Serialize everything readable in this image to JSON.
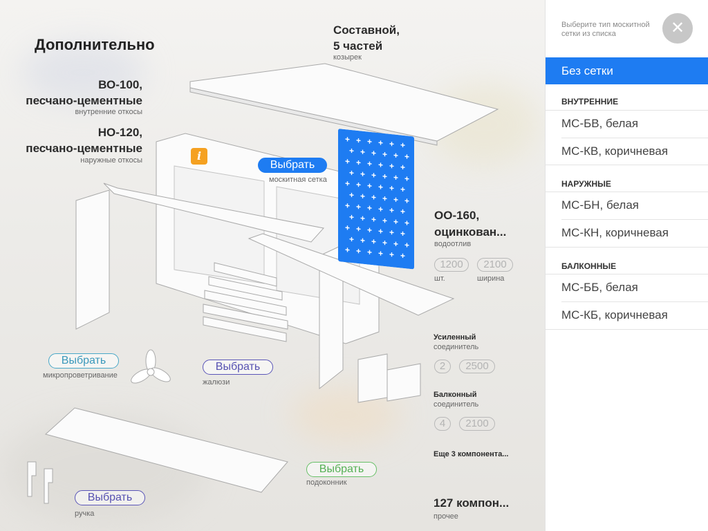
{
  "main": {
    "title": "Дополнительно",
    "visor": {
      "value_line1": "Составной,",
      "value_line2": "5 частей",
      "label": "козырек"
    },
    "inner_slopes": {
      "value_line1": "ВО-100,",
      "value_line2": "песчано-цементные",
      "label": "внутренние откосы"
    },
    "outer_slopes": {
      "value_line1": "НО-120,",
      "value_line2": "песчано-цементные",
      "label": "наружные откосы"
    },
    "mosquito": {
      "button": "Выбрать",
      "label": "москитная сетка"
    },
    "drip": {
      "value_line1": "ОО-160,",
      "value_line2": "оцинкован...",
      "label": "водоотлив",
      "qty": "1200",
      "qty_label": "шт.",
      "width": "2100",
      "width_label": "ширина"
    },
    "reinforced": {
      "title_line1": "Усиленный",
      "title_line2": "соединитель",
      "qty": "2",
      "width": "2500"
    },
    "balcony_conn": {
      "title_line1": "Балконный",
      "title_line2": "соединитель",
      "qty": "4",
      "width": "2100"
    },
    "more": "Еще 3 компонента...",
    "other": {
      "value": "127 компон...",
      "label": "прочее"
    },
    "micro": {
      "button": "Выбрать",
      "label": "микропроветривание"
    },
    "blinds": {
      "button": "Выбрать",
      "label": "жалюзи"
    },
    "sill": {
      "button": "Выбрать",
      "label": "подоконник"
    },
    "handle": {
      "button": "Выбрать",
      "label": "ручка"
    }
  },
  "panel": {
    "hint": "Выберите тип москитной сетки из списка",
    "close_icon": "close-icon",
    "selected": "Без сетки",
    "sections": [
      {
        "title": "ВНУТРЕННИЕ",
        "items": [
          "МС-БВ, белая",
          "МС-КВ, коричневая"
        ]
      },
      {
        "title": "НАРУЖНЫЕ",
        "items": [
          "МС-БН, белая",
          "МС-КН, коричневая"
        ]
      },
      {
        "title": "БАЛКОННЫЕ",
        "items": [
          "МС-ББ, белая",
          "МС-КБ, коричневая"
        ]
      }
    ]
  },
  "colors": {
    "accent": "#1e7cf2",
    "info": "#f5a121",
    "teal": "#4aa8c8",
    "purple": "#5a55b8",
    "green": "#67c067"
  }
}
